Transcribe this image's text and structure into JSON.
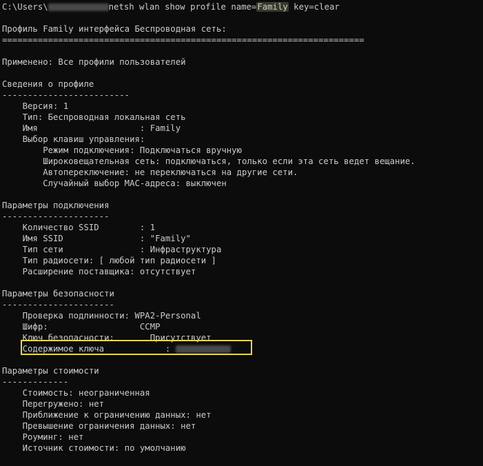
{
  "prompt": {
    "path_prefix": "C:\\Users\\",
    "command_mid": "netsh wlan show profile name=",
    "highlighted_name": "Family",
    "command_tail": " key=clear"
  },
  "header": {
    "profile_title": "Профиль Family интерфейса Беспроводная сеть:",
    "rule": "======================================================================="
  },
  "applied": "Применено: Все профили пользователей",
  "profile_info": {
    "title": "Сведения о профиле",
    "rule": "-------------------------",
    "version": "    Версия: 1",
    "type": "    Тип: Беспроводная локальная сеть",
    "name": "    Имя                    : Family",
    "key_choice": "    Выбор клавиш управления:",
    "connection_mode": "        Режим подключения: Подключаться вручную",
    "broadcast": "        Широковещательная сеть: подключаться, только если эта сеть ведет вещание.",
    "autoswitch": "        Автопереключение: не переключаться на другие сети.",
    "mac_random": "        Случайный выбор MAC-адреса: выключен"
  },
  "connection": {
    "title": "Параметры подключения",
    "rule": "---------------------",
    "ssid_count": "    Количество SSID        : 1",
    "ssid_name": "    Имя SSID               : \"Family\"",
    "net_type": "    Тип сети               : Инфраструктура",
    "radio_type": "    Тип радиосети: [ любой тип радиосети ]",
    "vendor_ext": "    Расширение поставщика: отсутствует"
  },
  "security": {
    "title": "Параметры безопасности",
    "rule": "----------------------",
    "auth": "    Проверка подлинности: WPA2-Personal",
    "cipher": "    Шифр:                  CCMP",
    "key": "    Ключ безопасности:       Присутствует",
    "key_content": "    Содержимое ключа            : "
  },
  "cost": {
    "title": "Параметры стоимости",
    "rule": "-------------",
    "cost": "    Стоимость: неограниченная",
    "congested": "    Перегружено: нет",
    "approaching": "    Приближение к ограничению данных: нет",
    "over_limit": "    Превышение ограничения данных: нет",
    "roaming": "    Роуминг: нет",
    "source": "    Источник стоимости: по умолчанию"
  },
  "colors": {
    "background": "#0c0c0c",
    "text": "#cccccc",
    "highlight_border": "#e6d84a"
  }
}
